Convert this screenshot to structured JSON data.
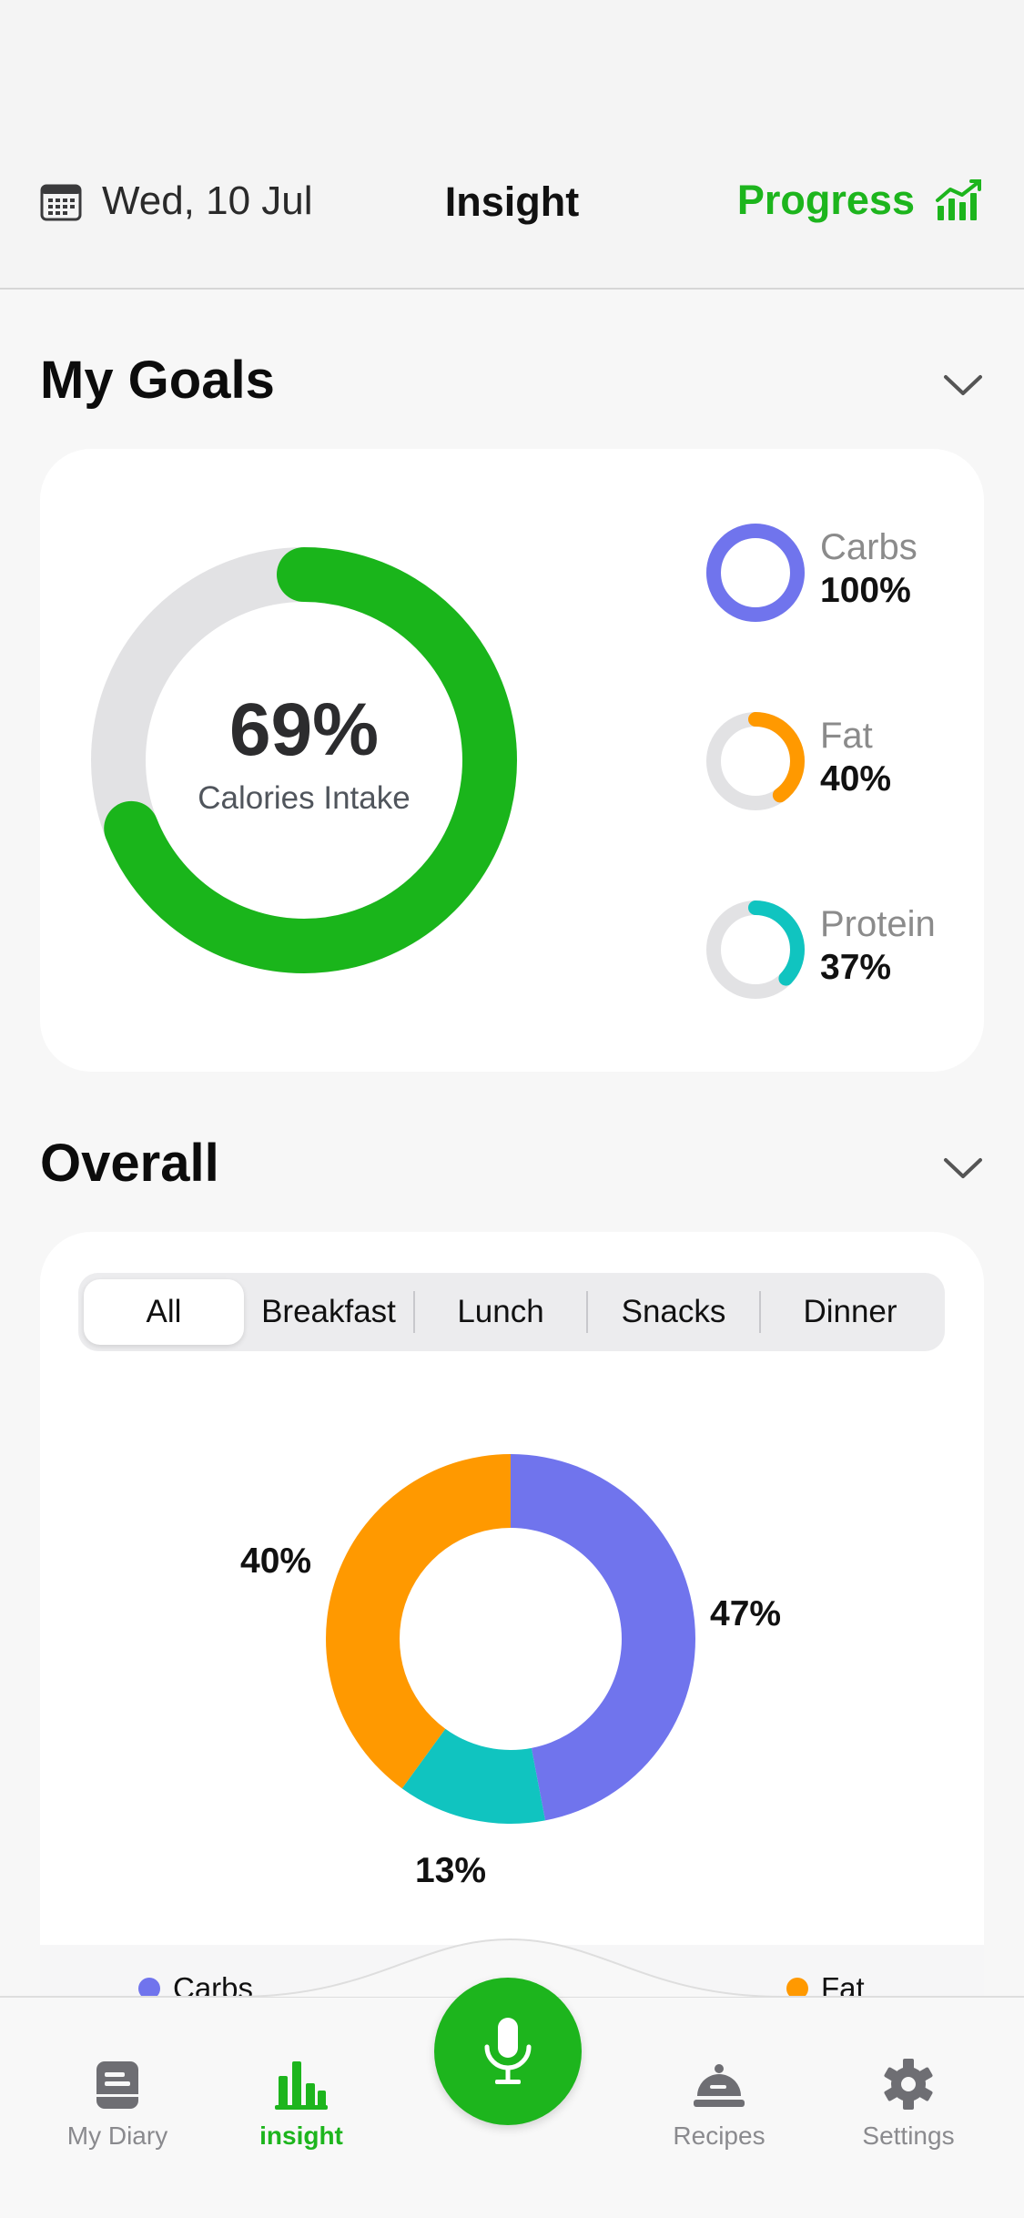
{
  "header": {
    "date": "Wed, 10 Jul",
    "title": "Insight",
    "progress_label": "Progress",
    "date_icon": "calendar-icon",
    "progress_icon": "chart-trend-icon"
  },
  "goals": {
    "title": "My Goals",
    "calories_pct": "69%",
    "calories_fraction": 0.69,
    "calories_label": "Calories Intake",
    "macros": [
      {
        "name": "Carbs",
        "value": "100%",
        "fraction": 1.0,
        "color": "#7074ed"
      },
      {
        "name": "Fat",
        "value": "40%",
        "fraction": 0.4,
        "color": "#ff9900"
      },
      {
        "name": "Protein",
        "value": "37%",
        "fraction": 0.37,
        "color": "#10c4c0"
      }
    ]
  },
  "overall": {
    "title": "Overall",
    "tabs": [
      "All",
      "Breakfast",
      "Lunch",
      "Snacks",
      "Dinner"
    ],
    "active_tab": "All",
    "legend": [
      {
        "name": "Carbs",
        "color": "#7074ed"
      },
      {
        "name": "Fat",
        "color": "#ff9900"
      }
    ]
  },
  "chart_data": {
    "type": "pie",
    "categories": [
      "Carbs",
      "Protein",
      "Fat"
    ],
    "values": [
      47,
      13,
      40
    ],
    "labels": [
      "47%",
      "13%",
      "40%"
    ],
    "colors": [
      "#7074ed",
      "#10c4c0",
      "#ff9900"
    ]
  },
  "tabbar": {
    "items": [
      {
        "label": "My Diary",
        "icon": "diary-icon"
      },
      {
        "label": "insight",
        "icon": "bar-chart-icon"
      },
      {
        "label": "Recipes",
        "icon": "cloche-icon"
      },
      {
        "label": "Settings",
        "icon": "gear-icon"
      }
    ],
    "center_icon": "microphone-icon",
    "accent": "#1db51d"
  }
}
